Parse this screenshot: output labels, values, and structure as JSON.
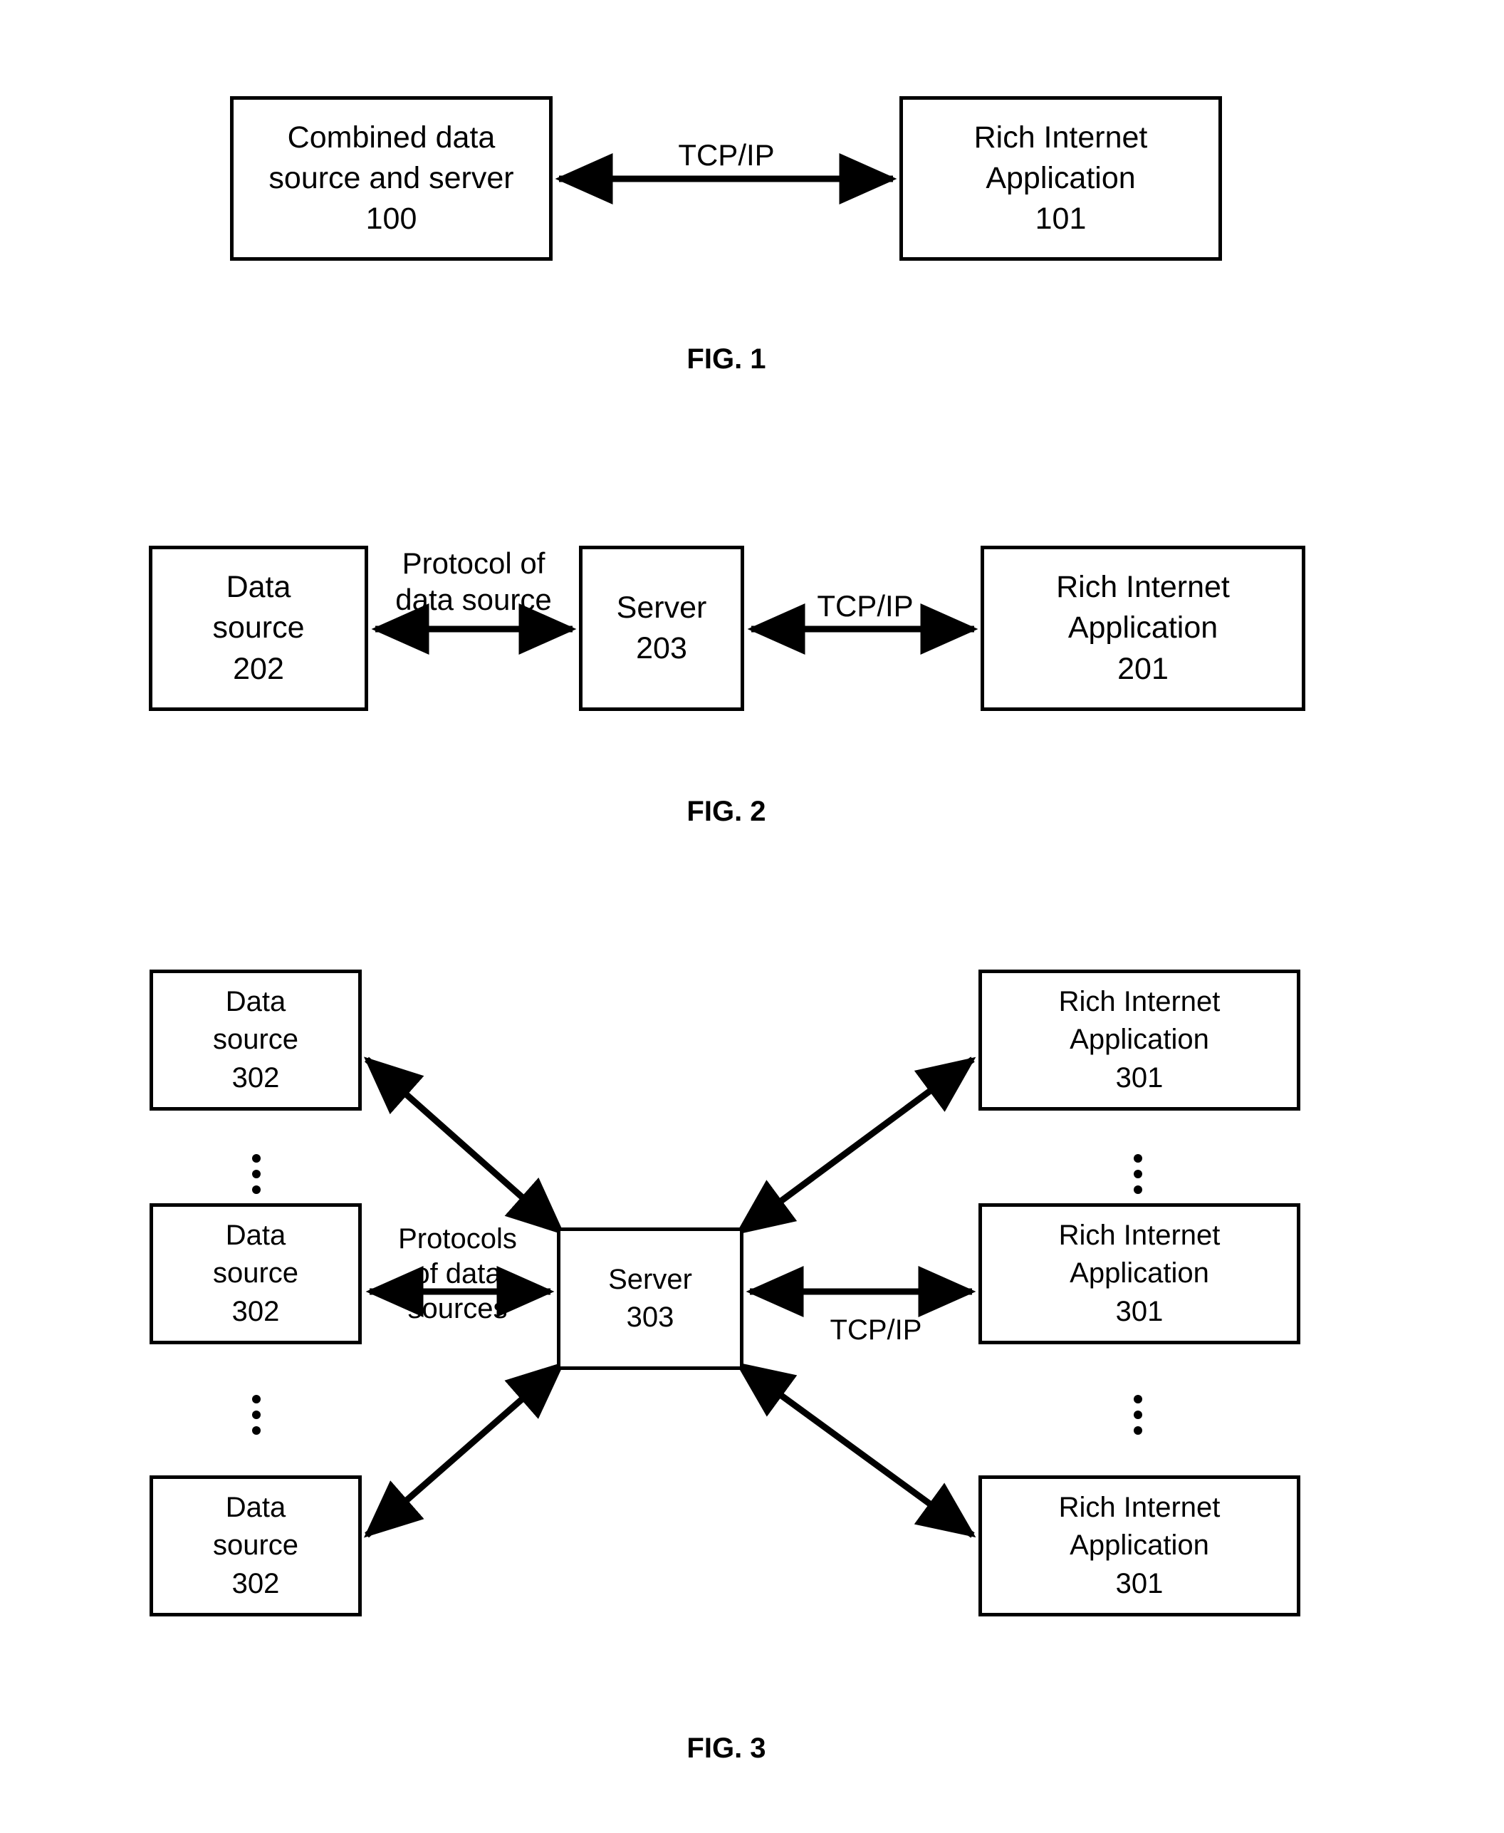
{
  "document": {
    "type": "patent-figure-sheet",
    "figures": [
      {
        "caption": "FIG. 1",
        "nodes": [
          {
            "id": "combined",
            "lines": [
              "Combined data",
              "source and server",
              "100"
            ]
          },
          {
            "id": "ria",
            "lines": [
              "Rich Internet",
              "Application",
              "101"
            ]
          }
        ],
        "edges": [
          {
            "id": "tcpip",
            "lines": [
              "TCP/IP"
            ],
            "style": "double-arrow"
          }
        ]
      },
      {
        "caption": "FIG. 2",
        "nodes": [
          {
            "id": "datasource",
            "lines": [
              "Data",
              "source",
              "202"
            ]
          },
          {
            "id": "server",
            "lines": [
              "Server",
              "203"
            ]
          },
          {
            "id": "ria",
            "lines": [
              "Rich Internet",
              "Application",
              "201"
            ]
          }
        ],
        "edges": [
          {
            "id": "protocol",
            "lines": [
              "Protocol of",
              "data source"
            ],
            "style": "double-arrow"
          },
          {
            "id": "tcpip",
            "lines": [
              "TCP/IP"
            ],
            "style": "double-arrow"
          }
        ]
      },
      {
        "caption": "FIG. 3",
        "nodes": [
          {
            "id": "ds1",
            "lines": [
              "Data",
              "source",
              "302"
            ]
          },
          {
            "id": "ds2",
            "lines": [
              "Data",
              "source",
              "302"
            ]
          },
          {
            "id": "ds3",
            "lines": [
              "Data",
              "source",
              "302"
            ]
          },
          {
            "id": "server",
            "lines": [
              "Server",
              "303"
            ]
          },
          {
            "id": "ria1",
            "lines": [
              "Rich Internet",
              "Application",
              "301"
            ]
          },
          {
            "id": "ria2",
            "lines": [
              "Rich Internet",
              "Application",
              "301"
            ]
          },
          {
            "id": "ria3",
            "lines": [
              "Rich Internet",
              "Application",
              "301"
            ]
          }
        ],
        "edges": [
          {
            "id": "protocols",
            "lines": [
              "Protocols",
              "of data",
              "sources"
            ],
            "style": "double-arrow"
          },
          {
            "id": "tcpip",
            "lines": [
              "TCP/IP"
            ],
            "style": "double-arrow"
          }
        ],
        "ellipses": [
          "vertical-ellipsis",
          "vertical-ellipsis",
          "vertical-ellipsis",
          "vertical-ellipsis"
        ]
      }
    ],
    "colors": {
      "stroke": "#000000",
      "background": "#ffffff",
      "text": "#000000"
    }
  },
  "fig1": {
    "caption": "FIG. 1",
    "combined": {
      "l1": "Combined data",
      "l2": "source and server",
      "l3": "100"
    },
    "ria": {
      "l1": "Rich Internet",
      "l2": "Application",
      "l3": "101"
    },
    "tcpip": "TCP/IP"
  },
  "fig2": {
    "caption": "FIG. 2",
    "datasource": {
      "l1": "Data",
      "l2": "source",
      "l3": "202"
    },
    "server": {
      "l1": "Server",
      "l2": "203"
    },
    "ria": {
      "l1": "Rich Internet",
      "l2": "Application",
      "l3": "201"
    },
    "protocol": {
      "l1": "Protocol of",
      "l2": "data source"
    },
    "tcpip": "TCP/IP"
  },
  "fig3": {
    "caption": "FIG. 3",
    "ds1": {
      "l1": "Data",
      "l2": "source",
      "l3": "302"
    },
    "ds2": {
      "l1": "Data",
      "l2": "source",
      "l3": "302"
    },
    "ds3": {
      "l1": "Data",
      "l2": "source",
      "l3": "302"
    },
    "server": {
      "l1": "Server",
      "l2": "303"
    },
    "ria1": {
      "l1": "Rich Internet",
      "l2": "Application",
      "l3": "301"
    },
    "ria2": {
      "l1": "Rich Internet",
      "l2": "Application",
      "l3": "301"
    },
    "ria3": {
      "l1": "Rich Internet",
      "l2": "Application",
      "l3": "301"
    },
    "protocols": {
      "l1": "Protocols",
      "l2": "of data",
      "l3": "sources"
    },
    "tcpip": "TCP/IP"
  }
}
